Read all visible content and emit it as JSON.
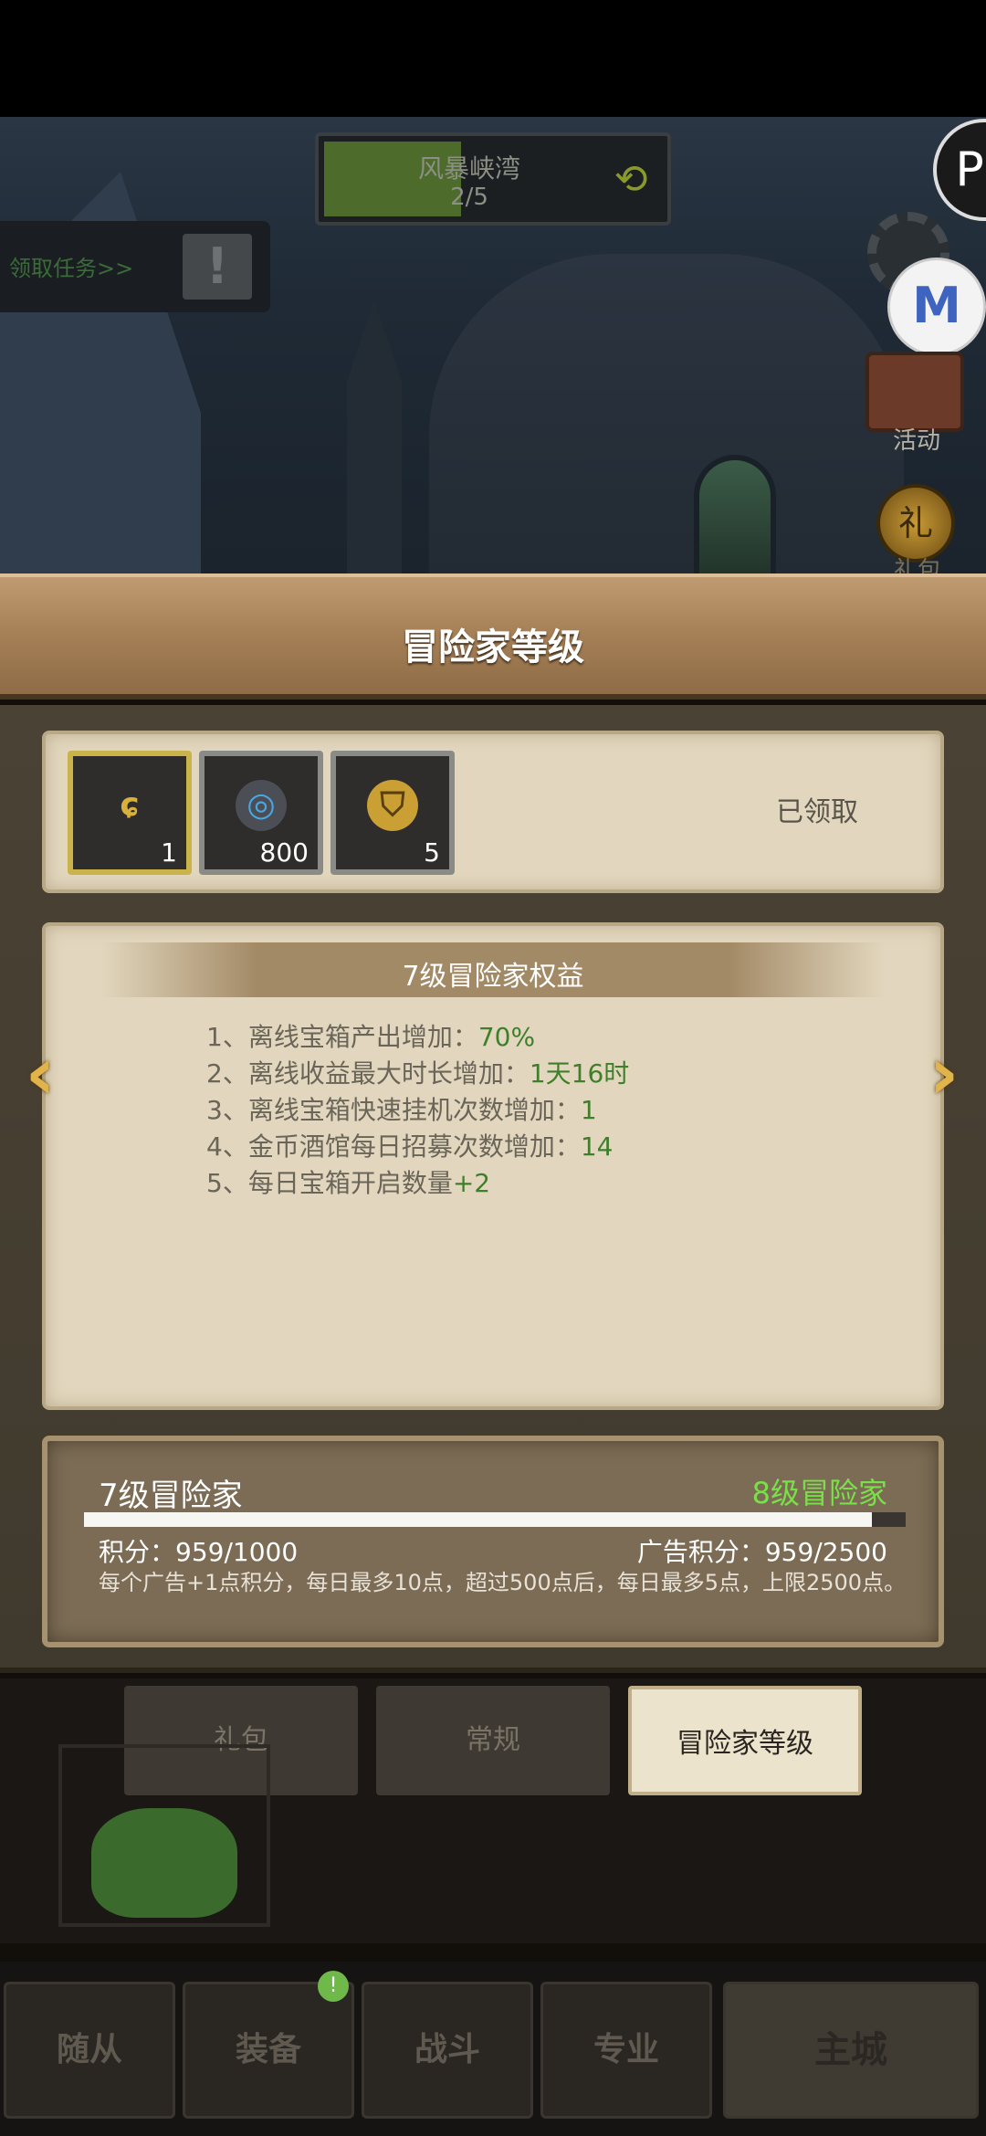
{
  "scene": {
    "stage_name": "风暴峡湾",
    "stage_progress": "2/5",
    "quest_link": "领取任务>>",
    "side": {
      "logo": "P",
      "badge": "M",
      "event_label": "活动",
      "gift_label": "礼包"
    }
  },
  "panel": {
    "title": "冒险家等级",
    "rewards": [
      {
        "icon": "hook-icon",
        "count": "1"
      },
      {
        "icon": "rune-stone-icon",
        "count": "800"
      },
      {
        "icon": "gold-token-icon",
        "count": "5"
      }
    ],
    "claimed_label": "已领取",
    "benefits_title": "7级冒险家权益",
    "benefits": [
      {
        "text": "1、离线宝箱产出增加：",
        "value": "70%"
      },
      {
        "text": "2、离线收益最大时长增加：",
        "value": "1天16时"
      },
      {
        "text": "3、离线宝箱快速挂机次数增加：",
        "value": "1"
      },
      {
        "text": "4、金币酒馆每日招募次数增加：",
        "value": "14"
      },
      {
        "text": "5、每日宝箱开启数量",
        "value": "+2"
      }
    ],
    "current_level": "7级冒险家",
    "next_level": "8级冒险家",
    "progress_fraction": 0.959,
    "points": "积分：959/1000",
    "ad_points": "广告积分：959/2500",
    "note": "每个广告+1点积分，每日最多10点，超过500点后，每日最多5点，上限2500点。"
  },
  "tabs": [
    {
      "label": "礼包",
      "active": false
    },
    {
      "label": "常规",
      "active": false
    },
    {
      "label": "冒险家等级",
      "active": true
    }
  ],
  "nav": [
    {
      "label": "随从"
    },
    {
      "label": "装备"
    },
    {
      "label": "战斗"
    },
    {
      "label": "专业"
    },
    {
      "label": "主城"
    }
  ],
  "nav_badge": "!",
  "colors": {
    "accent_green": "#7ae04a",
    "benefit_value": "#3f7f2a",
    "title_wood": "#a78157"
  }
}
